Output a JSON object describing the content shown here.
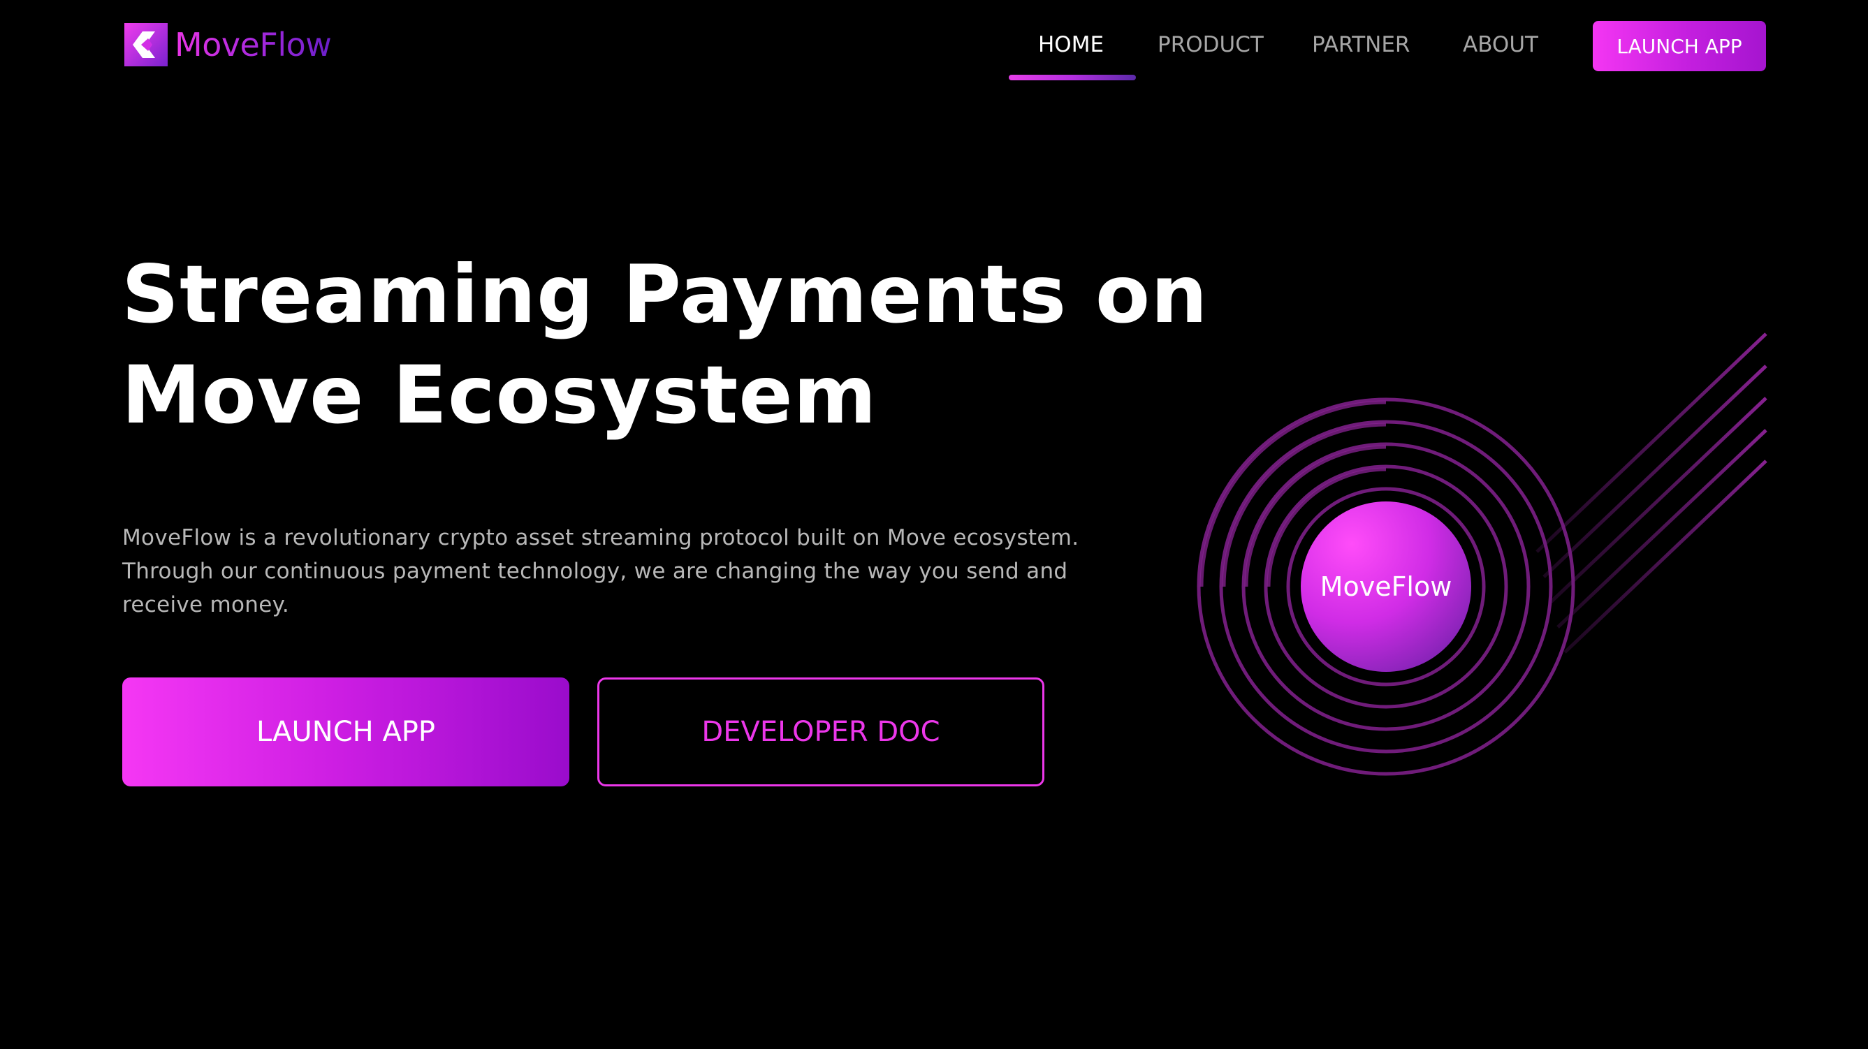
{
  "brand": {
    "name": "MoveFlow",
    "accent": "#ec37ea",
    "accent_dark": "#5e1f9e"
  },
  "nav": {
    "items": [
      {
        "label": "HOME",
        "active": true
      },
      {
        "label": "PRODUCT",
        "active": false
      },
      {
        "label": "PARTNER",
        "active": false
      },
      {
        "label": "ABOUT",
        "active": false
      }
    ],
    "launch_label": "LAUNCH APP"
  },
  "hero": {
    "title_lines": [
      "Streaming Payments on",
      "Move Ecosystem"
    ],
    "description": "MoveFlow is a revolutionary crypto asset streaming protocol built on Move ecosystem. Through our continuous payment technology, we are changing the way you send and receive money.",
    "primary_cta": "LAUNCH APP",
    "secondary_cta": "DEVELOPER DOC"
  },
  "illustration": {
    "badge_label": "MoveFlow"
  }
}
